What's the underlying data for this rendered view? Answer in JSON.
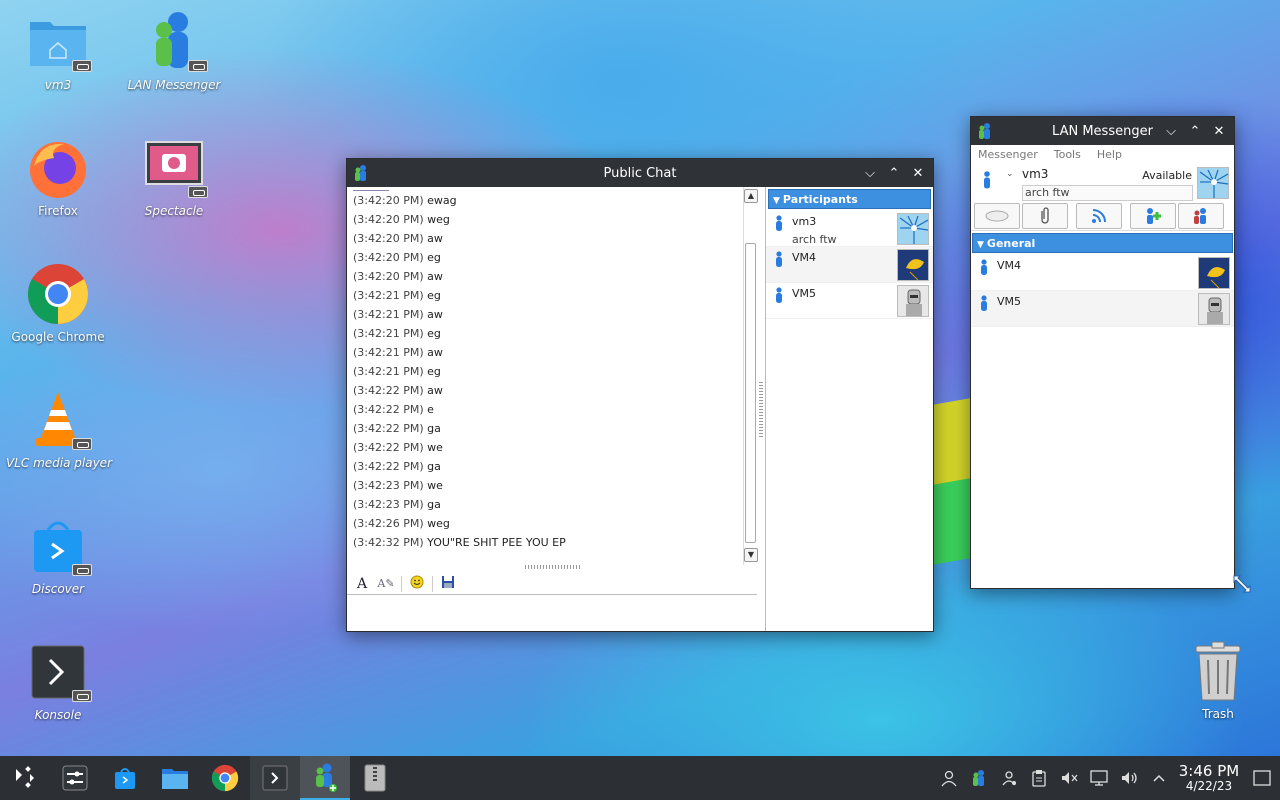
{
  "desktop": {
    "icons": [
      {
        "label": "vm3"
      },
      {
        "label": "LAN Messenger"
      },
      {
        "label": "Firefox"
      },
      {
        "label": "Spectacle"
      },
      {
        "label": "Google Chrome"
      },
      {
        "label": "VLC media player"
      },
      {
        "label": "Discover"
      },
      {
        "label": "Konsole"
      }
    ],
    "trash": {
      "label": "Trash"
    }
  },
  "chat_window": {
    "title": "Public Chat",
    "messages": [
      {
        "time": "(3:42:20 PM)",
        "text": "ewag"
      },
      {
        "time": "(3:42:20 PM)",
        "text": "weg"
      },
      {
        "time": "(3:42:20 PM)",
        "text": "aw"
      },
      {
        "time": "(3:42:20 PM)",
        "text": "eg"
      },
      {
        "time": "(3:42:20 PM)",
        "text": "aw"
      },
      {
        "time": "(3:42:21 PM)",
        "text": "eg"
      },
      {
        "time": "(3:42:21 PM)",
        "text": "aw"
      },
      {
        "time": "(3:42:21 PM)",
        "text": "eg"
      },
      {
        "time": "(3:42:21 PM)",
        "text": "aw"
      },
      {
        "time": "(3:42:21 PM)",
        "text": "eg"
      },
      {
        "time": "(3:42:22 PM)",
        "text": "aw"
      },
      {
        "time": "(3:42:22 PM)",
        "text": "e"
      },
      {
        "time": "(3:42:22 PM)",
        "text": "ga"
      },
      {
        "time": "(3:42:22 PM)",
        "text": "we"
      },
      {
        "time": "(3:42:22 PM)",
        "text": "ga"
      },
      {
        "time": "(3:42:23 PM)",
        "text": "we"
      },
      {
        "time": "(3:42:23 PM)",
        "text": "ga"
      },
      {
        "time": "(3:42:26 PM)",
        "text": "weg"
      },
      {
        "time": "(3:42:32 PM)",
        "text": "YOU\"RE SHIT PEE YOU EP"
      }
    ],
    "participants_header": "Participants",
    "participants": [
      {
        "name": "vm3",
        "status": "arch ftw"
      },
      {
        "name": "VM4",
        "status": ""
      },
      {
        "name": "VM5",
        "status": ""
      }
    ]
  },
  "lan_window": {
    "title": "LAN Messenger",
    "menu": [
      "Messenger",
      "Tools",
      "Help"
    ],
    "me": {
      "name": "vm3",
      "status": "Available",
      "note": "arch ftw"
    },
    "group_header": "General",
    "contacts": [
      {
        "name": "VM4"
      },
      {
        "name": "VM5"
      }
    ]
  },
  "taskbar": {
    "time": "3:46 PM",
    "date": "4/22/23"
  },
  "colors": {
    "titlebar": "#2f3236",
    "section_header": "#3d8fe0",
    "taskbar": "#2c3035",
    "accent": "#3daee9"
  }
}
